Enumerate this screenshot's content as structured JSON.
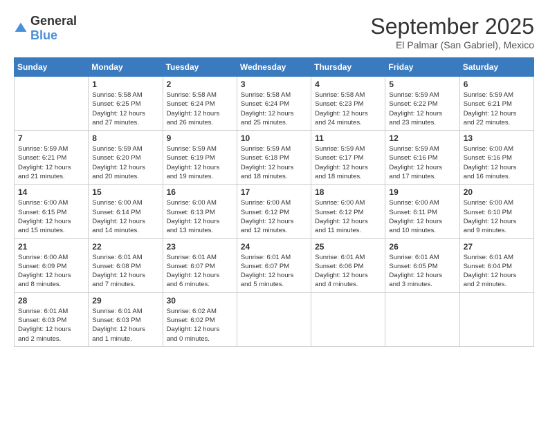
{
  "header": {
    "logo_general": "General",
    "logo_blue": "Blue",
    "month": "September 2025",
    "location": "El Palmar (San Gabriel), Mexico"
  },
  "weekdays": [
    "Sunday",
    "Monday",
    "Tuesday",
    "Wednesday",
    "Thursday",
    "Friday",
    "Saturday"
  ],
  "weeks": [
    [
      {
        "day": "",
        "info": ""
      },
      {
        "day": "1",
        "info": "Sunrise: 5:58 AM\nSunset: 6:25 PM\nDaylight: 12 hours\nand 27 minutes."
      },
      {
        "day": "2",
        "info": "Sunrise: 5:58 AM\nSunset: 6:24 PM\nDaylight: 12 hours\nand 26 minutes."
      },
      {
        "day": "3",
        "info": "Sunrise: 5:58 AM\nSunset: 6:24 PM\nDaylight: 12 hours\nand 25 minutes."
      },
      {
        "day": "4",
        "info": "Sunrise: 5:58 AM\nSunset: 6:23 PM\nDaylight: 12 hours\nand 24 minutes."
      },
      {
        "day": "5",
        "info": "Sunrise: 5:59 AM\nSunset: 6:22 PM\nDaylight: 12 hours\nand 23 minutes."
      },
      {
        "day": "6",
        "info": "Sunrise: 5:59 AM\nSunset: 6:21 PM\nDaylight: 12 hours\nand 22 minutes."
      }
    ],
    [
      {
        "day": "7",
        "info": "Sunrise: 5:59 AM\nSunset: 6:21 PM\nDaylight: 12 hours\nand 21 minutes."
      },
      {
        "day": "8",
        "info": "Sunrise: 5:59 AM\nSunset: 6:20 PM\nDaylight: 12 hours\nand 20 minutes."
      },
      {
        "day": "9",
        "info": "Sunrise: 5:59 AM\nSunset: 6:19 PM\nDaylight: 12 hours\nand 19 minutes."
      },
      {
        "day": "10",
        "info": "Sunrise: 5:59 AM\nSunset: 6:18 PM\nDaylight: 12 hours\nand 18 minutes."
      },
      {
        "day": "11",
        "info": "Sunrise: 5:59 AM\nSunset: 6:17 PM\nDaylight: 12 hours\nand 18 minutes."
      },
      {
        "day": "12",
        "info": "Sunrise: 5:59 AM\nSunset: 6:16 PM\nDaylight: 12 hours\nand 17 minutes."
      },
      {
        "day": "13",
        "info": "Sunrise: 6:00 AM\nSunset: 6:16 PM\nDaylight: 12 hours\nand 16 minutes."
      }
    ],
    [
      {
        "day": "14",
        "info": "Sunrise: 6:00 AM\nSunset: 6:15 PM\nDaylight: 12 hours\nand 15 minutes."
      },
      {
        "day": "15",
        "info": "Sunrise: 6:00 AM\nSunset: 6:14 PM\nDaylight: 12 hours\nand 14 minutes."
      },
      {
        "day": "16",
        "info": "Sunrise: 6:00 AM\nSunset: 6:13 PM\nDaylight: 12 hours\nand 13 minutes."
      },
      {
        "day": "17",
        "info": "Sunrise: 6:00 AM\nSunset: 6:12 PM\nDaylight: 12 hours\nand 12 minutes."
      },
      {
        "day": "18",
        "info": "Sunrise: 6:00 AM\nSunset: 6:12 PM\nDaylight: 12 hours\nand 11 minutes."
      },
      {
        "day": "19",
        "info": "Sunrise: 6:00 AM\nSunset: 6:11 PM\nDaylight: 12 hours\nand 10 minutes."
      },
      {
        "day": "20",
        "info": "Sunrise: 6:00 AM\nSunset: 6:10 PM\nDaylight: 12 hours\nand 9 minutes."
      }
    ],
    [
      {
        "day": "21",
        "info": "Sunrise: 6:00 AM\nSunset: 6:09 PM\nDaylight: 12 hours\nand 8 minutes."
      },
      {
        "day": "22",
        "info": "Sunrise: 6:01 AM\nSunset: 6:08 PM\nDaylight: 12 hours\nand 7 minutes."
      },
      {
        "day": "23",
        "info": "Sunrise: 6:01 AM\nSunset: 6:07 PM\nDaylight: 12 hours\nand 6 minutes."
      },
      {
        "day": "24",
        "info": "Sunrise: 6:01 AM\nSunset: 6:07 PM\nDaylight: 12 hours\nand 5 minutes."
      },
      {
        "day": "25",
        "info": "Sunrise: 6:01 AM\nSunset: 6:06 PM\nDaylight: 12 hours\nand 4 minutes."
      },
      {
        "day": "26",
        "info": "Sunrise: 6:01 AM\nSunset: 6:05 PM\nDaylight: 12 hours\nand 3 minutes."
      },
      {
        "day": "27",
        "info": "Sunrise: 6:01 AM\nSunset: 6:04 PM\nDaylight: 12 hours\nand 2 minutes."
      }
    ],
    [
      {
        "day": "28",
        "info": "Sunrise: 6:01 AM\nSunset: 6:03 PM\nDaylight: 12 hours\nand 2 minutes."
      },
      {
        "day": "29",
        "info": "Sunrise: 6:01 AM\nSunset: 6:03 PM\nDaylight: 12 hours\nand 1 minute."
      },
      {
        "day": "30",
        "info": "Sunrise: 6:02 AM\nSunset: 6:02 PM\nDaylight: 12 hours\nand 0 minutes."
      },
      {
        "day": "",
        "info": ""
      },
      {
        "day": "",
        "info": ""
      },
      {
        "day": "",
        "info": ""
      },
      {
        "day": "",
        "info": ""
      }
    ]
  ]
}
